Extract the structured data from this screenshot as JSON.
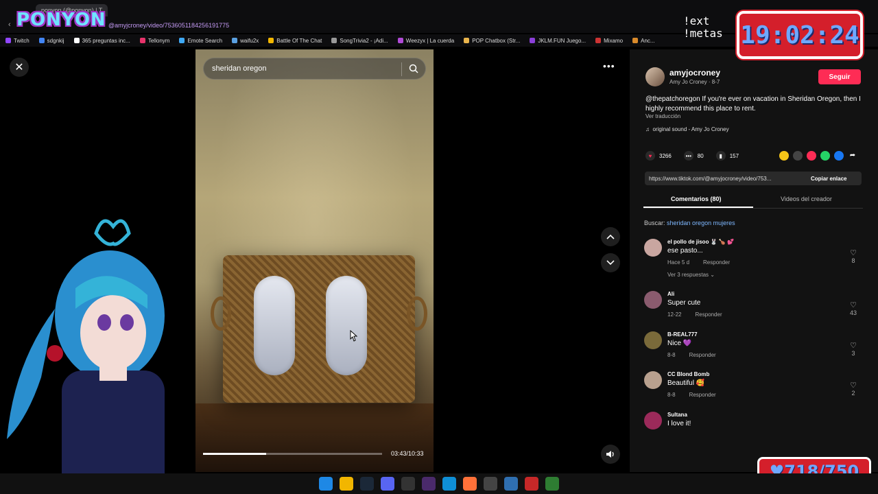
{
  "browser": {
    "tab_title": "ponyon (@ponyon) | T",
    "url": "@amyjcroney/video/7536051184256191775",
    "bookmarks": [
      "Twitch",
      "sdgnkij",
      "365 preguntas inc...",
      "Tellonym",
      "Emote Search",
      "waifu2x",
      "Battle Of The Chat",
      "SongTrivia2 - ¡Adi...",
      "Weezyx | La cuerda",
      "POP Chatbox (Str...",
      "JKLM.FUN Juego...",
      "Mixamo",
      "Anc..."
    ]
  },
  "video": {
    "search_text": "sheridan oregon",
    "time": "03:43/10:33",
    "progress_fraction": 0.352
  },
  "post": {
    "username": "amyjocroney",
    "display_name": "Amy Jo Croney · 8-7",
    "follow_label": "Seguir",
    "description": "@thepatchoregon If you're ever on vacation in Sheridan Oregon, then I highly recommend this place to rent.",
    "translate_label": "Ver traducción",
    "sound": "original sound - Amy Jo Croney",
    "likes": "3266",
    "comments": "80",
    "saves": "157",
    "link": "https://www.tiktok.com/@amyjocroney/video/753...",
    "copy_label": "Copiar enlace"
  },
  "tabs": {
    "comments": "Comentarios (80)",
    "creator_videos": "Videos del creador"
  },
  "search_suggestion": {
    "prefix": "Buscar:",
    "query": "sheridan oregon mujeres"
  },
  "comments": [
    {
      "user": "el pollo de jisoo 🐰 🍗 💕",
      "text": "ese pasto...",
      "date": "Hace 5 d",
      "reply": "Responder",
      "likes": "8",
      "replies": "Ver 3 respuestas ⌄",
      "color": "#c9a6a0"
    },
    {
      "user": "Ali",
      "text": "Super cute",
      "date": "12-22",
      "reply": "Responder",
      "likes": "43",
      "color": "#8a5b6e"
    },
    {
      "user": "B-REAL777",
      "text": "Nice 💜",
      "date": "8-8",
      "reply": "Responder",
      "likes": "3",
      "color": "#7a6a3a"
    },
    {
      "user": "CC Blond Bomb",
      "text": "Beautiful 🥰",
      "date": "8-8",
      "reply": "Responder",
      "likes": "2",
      "color": "#b8a08e"
    },
    {
      "user": "Sultana",
      "text": "I love it!",
      "color": "#9b2a5a"
    }
  ],
  "overlay": {
    "logo": "PONYON",
    "commands": [
      "!ext",
      "!metas"
    ],
    "clock": "19:02:24",
    "counter": "♥718/750"
  },
  "colors": {
    "accent": "#fe2c55",
    "panel_bg": "#121212",
    "overlay_red": "#d41f2b"
  },
  "icons": [
    "close-icon",
    "search-icon",
    "more-icon",
    "chevron-up-icon",
    "chevron-down-icon",
    "volume-icon",
    "heart-icon",
    "comment-icon",
    "bookmark-icon"
  ]
}
